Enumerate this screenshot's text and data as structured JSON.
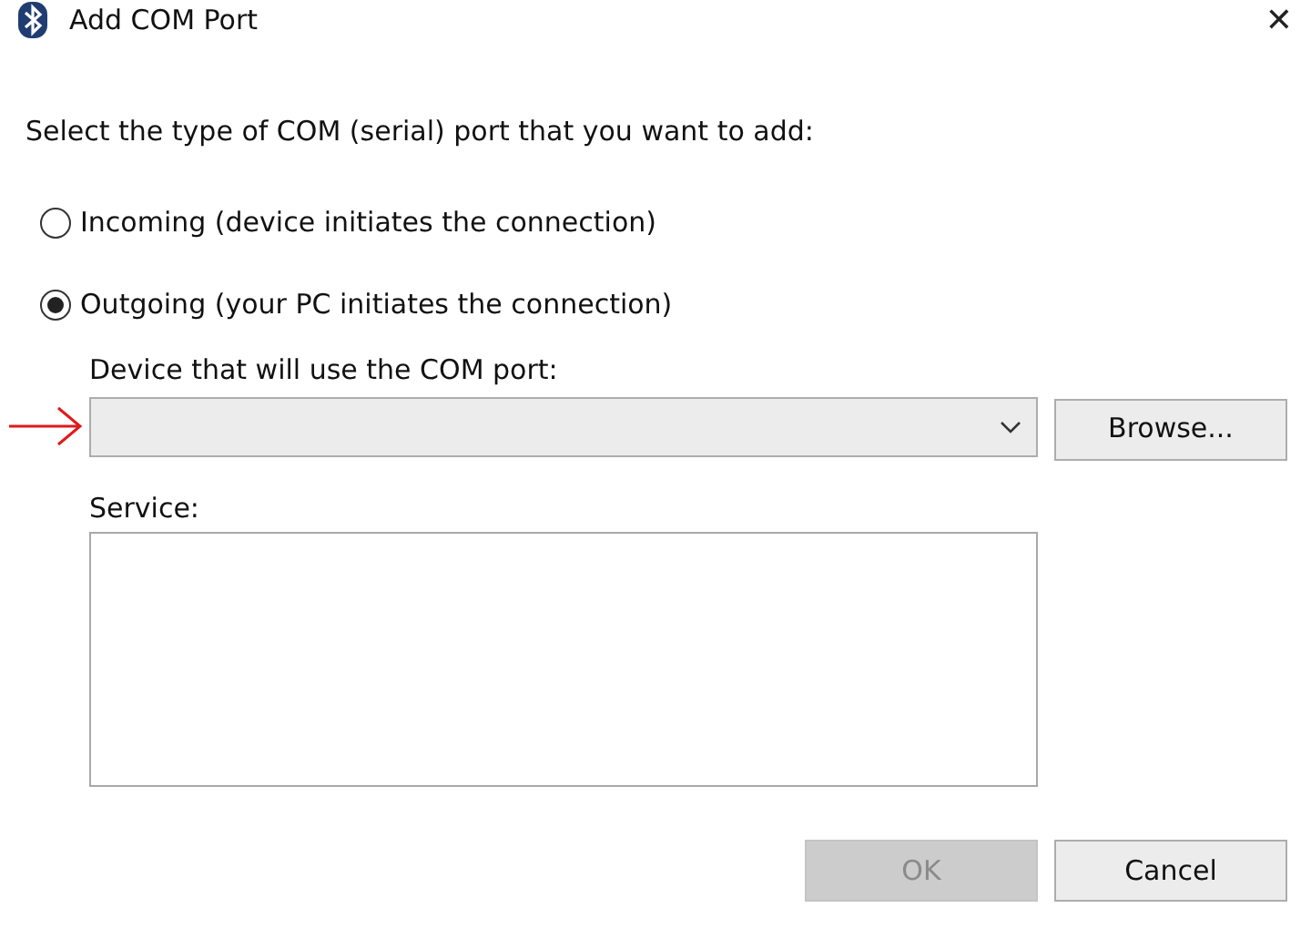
{
  "window": {
    "title": "Add COM Port",
    "close": "✕"
  },
  "instruction": "Select the type of COM (serial) port that you want to add:",
  "port_types": [
    {
      "label": "Incoming (device initiates the connection)",
      "selected": false
    },
    {
      "label": "Outgoing (your PC initiates the connection)",
      "selected": true
    }
  ],
  "device": {
    "label": "Device that will use the COM port:",
    "browse": "Browse..."
  },
  "service": {
    "label": "Service:"
  },
  "buttons": [
    {
      "label": "OK",
      "disabled": true
    },
    {
      "label": "Cancel",
      "disabled": false
    }
  ]
}
